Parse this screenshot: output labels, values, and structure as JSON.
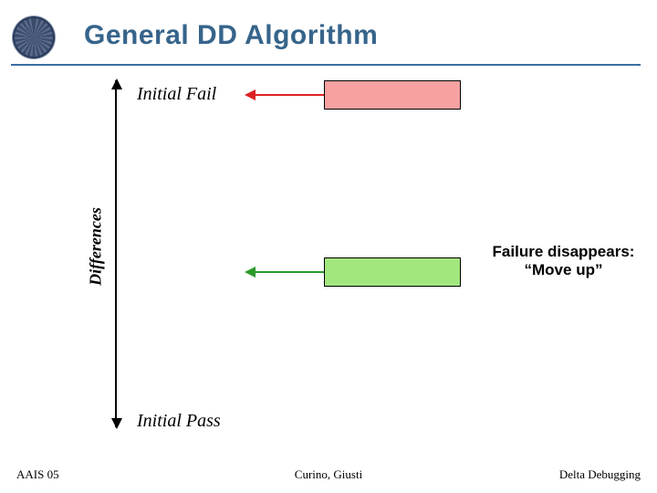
{
  "title": "General DD Algorithm",
  "axis_label": "Differences",
  "top_label": "Initial Fail",
  "bottom_label": "Initial Pass",
  "annotation": {
    "line1": "Failure disappears:",
    "line2": "“Move up”"
  },
  "footer": {
    "left": "AAIS 05",
    "center": "Curino, Giusti",
    "right": "Delta Debugging"
  },
  "colors": {
    "title": "#36648b",
    "fail_box": "#f7a1a1",
    "pass_box": "#a2e77e",
    "arrow_red": "#d22",
    "arrow_green": "#2a9a2a"
  },
  "chart_data": {
    "type": "diagram",
    "axis": {
      "label": "Differences",
      "orientation": "vertical",
      "endpoints": [
        "Initial Fail",
        "Initial Pass"
      ]
    },
    "nodes": [
      {
        "id": "fail-box",
        "vpos": "top",
        "color": "#f7a1a1"
      },
      {
        "id": "pass-box",
        "vpos": "middle",
        "color": "#a2e77e"
      }
    ],
    "arrows": [
      {
        "from": "fail-box",
        "direction": "left",
        "color": "red"
      },
      {
        "from": "pass-box",
        "direction": "left",
        "color": "green"
      }
    ],
    "annotations": [
      {
        "target": "pass-box",
        "text": "Failure disappears: “Move up”"
      }
    ]
  }
}
